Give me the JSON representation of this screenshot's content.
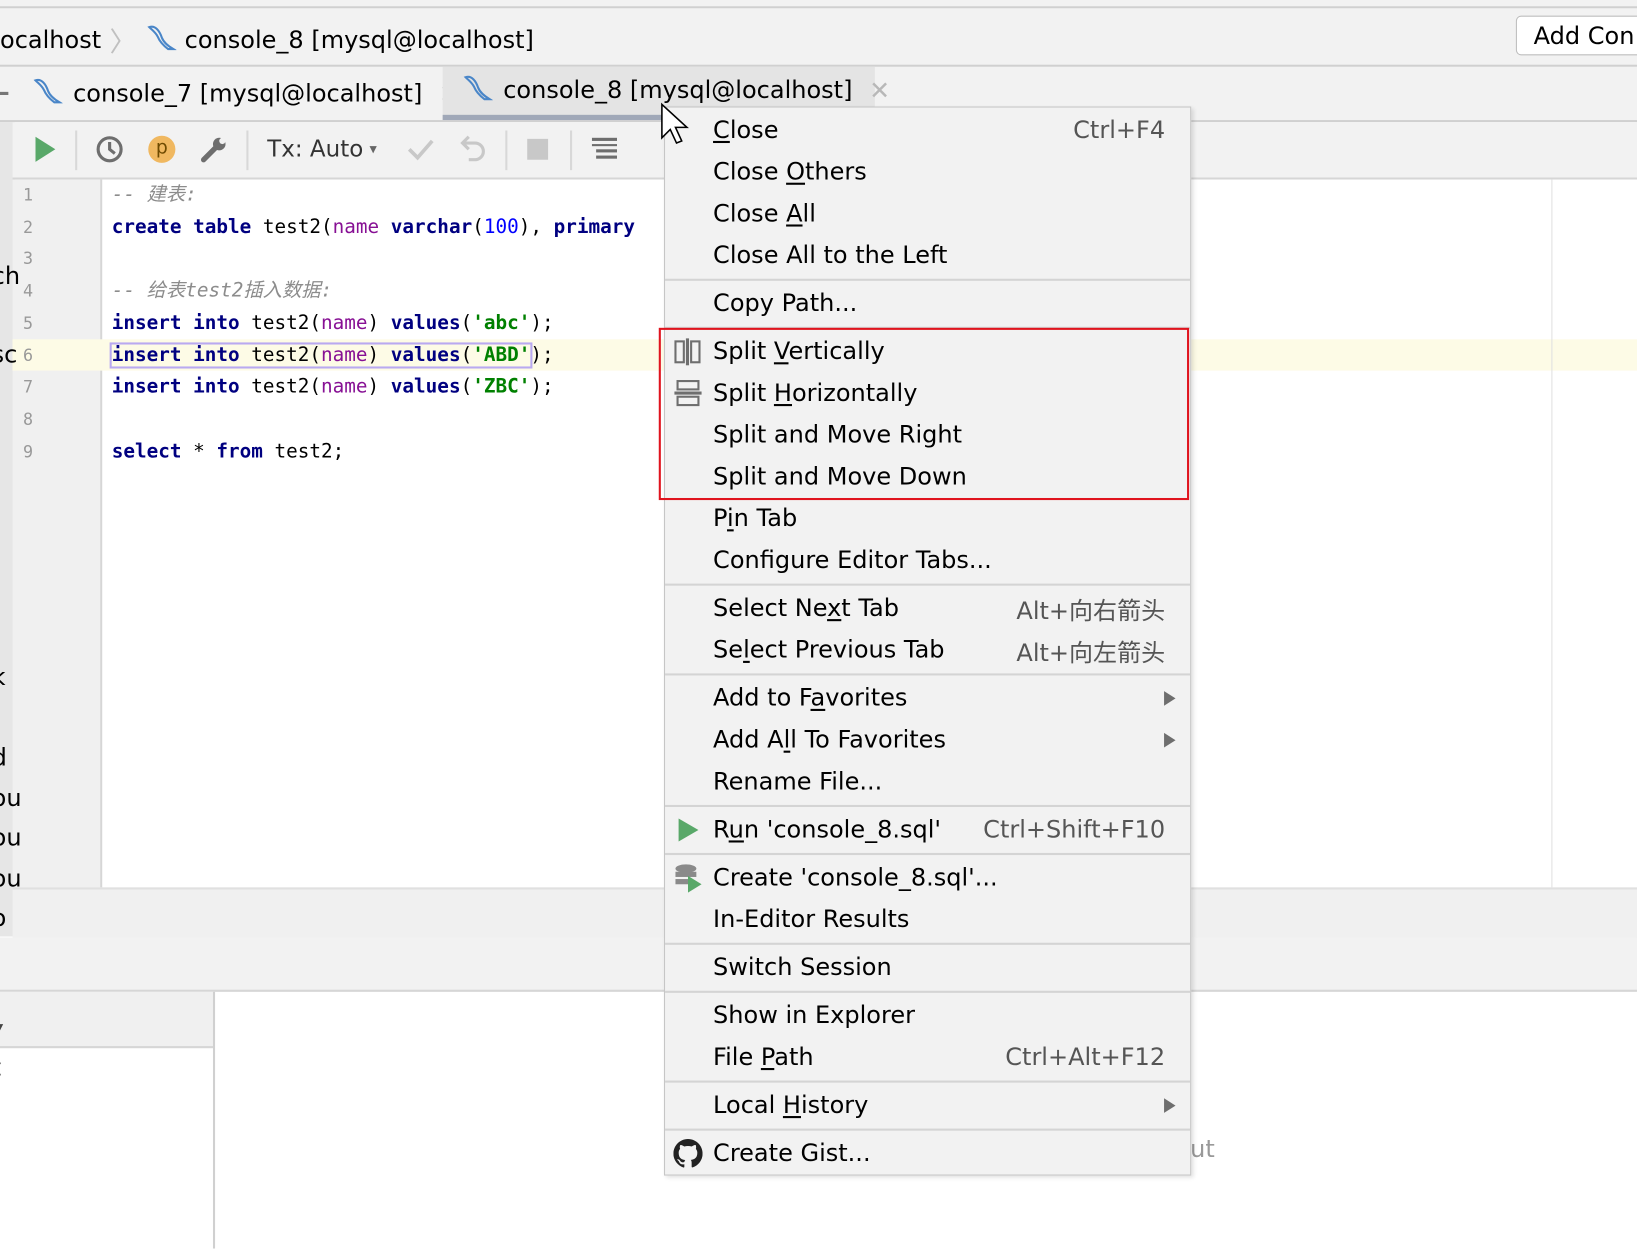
{
  "breadcrumb": {
    "items": [
      "ocalhost",
      "console_8 [mysql@localhost]"
    ]
  },
  "toolbar_right": {
    "add_config_label": "Add Con"
  },
  "tabs": [
    {
      "label": "console_7 [mysql@localhost]",
      "active": false
    },
    {
      "label": "console_8 [mysql@localhost]",
      "active": true
    }
  ],
  "editor_toolbar": {
    "tx_mode": "Tx: Auto",
    "profile_badge": "p"
  },
  "editor": {
    "current_line": 6,
    "lines": [
      [
        [
          "cm",
          "-- 建表:"
        ]
      ],
      [
        [
          "kw",
          "create table "
        ],
        [
          "id",
          "test2("
        ],
        [
          "col",
          "name "
        ],
        [
          "kw",
          "varchar"
        ],
        [
          "id",
          "("
        ],
        [
          "num",
          "100"
        ],
        [
          "id",
          "), "
        ],
        [
          "kw",
          "primary"
        ]
      ],
      [],
      [
        [
          "cm",
          "-- 给表test2插入数据:"
        ]
      ],
      [
        [
          "kw",
          "insert into "
        ],
        [
          "id",
          "test2("
        ],
        [
          "col",
          "name"
        ],
        [
          "id",
          ") "
        ],
        [
          "kw",
          "values"
        ],
        [
          "id",
          "("
        ],
        [
          "str",
          "'abc'"
        ],
        [
          "id",
          ");"
        ]
      ],
      [
        [
          "kw",
          "insert into "
        ],
        [
          "id",
          "test2("
        ],
        [
          "col",
          "name"
        ],
        [
          "id",
          ") "
        ],
        [
          "kw",
          "values"
        ],
        [
          "id",
          "("
        ],
        [
          "str",
          "'ABD'"
        ],
        [
          "id",
          ");"
        ]
      ],
      [
        [
          "kw",
          "insert into "
        ],
        [
          "id",
          "test2("
        ],
        [
          "col",
          "name"
        ],
        [
          "id",
          ") "
        ],
        [
          "kw",
          "values"
        ],
        [
          "id",
          "("
        ],
        [
          "str",
          "'ZBC'"
        ],
        [
          "id",
          ");"
        ]
      ],
      [],
      [
        [
          "kw",
          "select "
        ],
        [
          "id",
          "* "
        ],
        [
          "kw",
          "from "
        ],
        [
          "id",
          "test2;"
        ]
      ]
    ]
  },
  "left_fragments": [
    "ch",
    "sc",
    "k",
    "d",
    "ou",
    "ou",
    "ou",
    "o",
    "t"
  ],
  "background_fragment": "ut",
  "context_menu": {
    "groups": [
      [
        {
          "label": "Close",
          "mn": 0,
          "shortcut": "Ctrl+F4"
        },
        {
          "label": "Close Others",
          "mn": 6
        },
        {
          "label": "Close All",
          "mn": 6
        },
        {
          "label": "Close All to the Left"
        }
      ],
      [
        {
          "label": "Copy Path..."
        }
      ],
      [
        {
          "label": "Split Vertically",
          "mn": 6,
          "icon": "split-vertically-icon"
        },
        {
          "label": "Split Horizontally",
          "mn": 6,
          "icon": "split-horizontally-icon"
        },
        {
          "label": "Split and Move Right"
        },
        {
          "label": "Split and Move Down"
        },
        {
          "label": "Pin Tab",
          "mn": 1
        },
        {
          "label": "Configure Editor Tabs..."
        }
      ],
      [
        {
          "label": "Select Next Tab",
          "mn": 9,
          "shortcut": "Alt+向右箭头"
        },
        {
          "label": "Select Previous Tab",
          "mn": 2,
          "shortcut": "Alt+向左箭头"
        }
      ],
      [
        {
          "label": "Add to Favorites",
          "mn": 8,
          "submenu": true
        },
        {
          "label": "Add All To Favorites",
          "mn": 5,
          "submenu": true
        },
        {
          "label": "Rename File..."
        }
      ],
      [
        {
          "label": "Run 'console_8.sql'",
          "mn": 1,
          "shortcut": "Ctrl+Shift+F10",
          "icon": "run-icon"
        }
      ],
      [
        {
          "label": "Create 'console_8.sql'...",
          "icon": "database-run-icon"
        },
        {
          "label": "In-Editor Results"
        }
      ],
      [
        {
          "label": "Switch Session"
        }
      ],
      [
        {
          "label": "Show in Explorer"
        },
        {
          "label": "File Path",
          "mn": 5,
          "shortcut": "Ctrl+Alt+F12"
        }
      ],
      [
        {
          "label": "Local History",
          "mn": 6,
          "submenu": true
        }
      ],
      [
        {
          "label": "Create Gist...",
          "icon": "github-icon"
        }
      ]
    ]
  },
  "colors": {
    "highlight_box": "#e0141e",
    "run_green": "#59a869",
    "active_tab_underline": "#a0a8b8",
    "current_line": "#fdfbe6"
  }
}
